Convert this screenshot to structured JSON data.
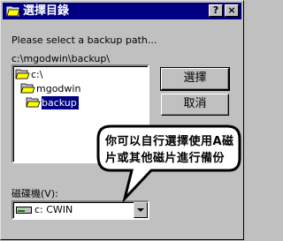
{
  "window": {
    "title": "選擇目錄",
    "help_label": "?",
    "close_label": "×"
  },
  "prompt": "Please select a backup path...",
  "current_path": "c:\\mgodwin\\backup\\",
  "directory_tree": [
    {
      "label": "c:\\",
      "icon": "open-folder-icon",
      "selected": false
    },
    {
      "label": "mgodwin",
      "icon": "open-folder-icon",
      "selected": false
    },
    {
      "label": "backup",
      "icon": "open-folder-icon",
      "selected": true
    }
  ],
  "buttons": {
    "ok_label": "選擇",
    "cancel_label": "取消"
  },
  "drive": {
    "label": "磁碟機(V):",
    "value": "c: CWIN",
    "icon": "hard-drive-icon"
  },
  "callout": {
    "text": "你可以自行選擇使用A磁片或其他磁片進行備份"
  },
  "colors": {
    "titlebar": "#000080",
    "face": "#c0c0c0",
    "selection": "#000080",
    "folder": "#ffff00"
  }
}
